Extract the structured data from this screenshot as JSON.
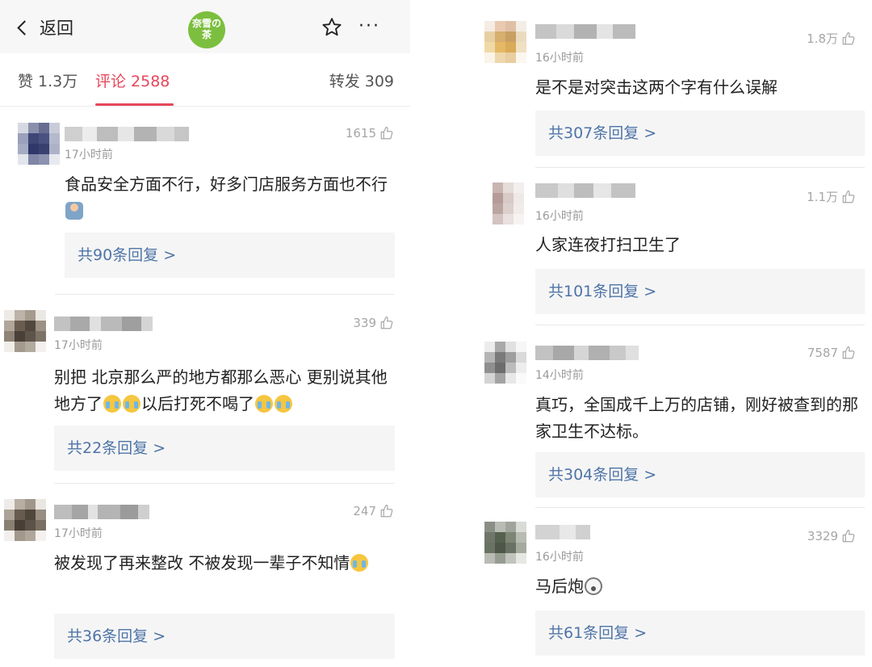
{
  "header": {
    "back_label": "返回",
    "logo_text": "奈雪の茶",
    "more_label": "···"
  },
  "tabs": {
    "likes": "赞 1.3万",
    "comments": "评论 2588",
    "reposts": "转发 309"
  },
  "accent_color": "#e7465a",
  "link_color": "#4e74a8",
  "left_comments": [
    {
      "time": "17小时前",
      "likes": "1615",
      "text": "食品安全方面不行，好多门店服务方面也不行",
      "replies": "共90条回复 >"
    },
    {
      "time": "17小时前",
      "likes": "339",
      "text": "别把 北京那么严的地方都那么恶心 更别说其他地方了",
      "text2": "以后打死不喝了",
      "replies": "共22条回复 >"
    },
    {
      "time": "17小时前",
      "likes": "247",
      "text": "被发现了再来整改 不被发现一辈子不知情",
      "replies": "共36条回复 >"
    }
  ],
  "right_comments": [
    {
      "time": "16小时前",
      "likes": "1.8万",
      "text": "是不是对突击这两个字有什么误解",
      "replies": "共307条回复 >"
    },
    {
      "time": "16小时前",
      "likes": "1.1万",
      "text": "人家连夜打扫卫生了",
      "replies": "共101条回复 >"
    },
    {
      "time": "14小时前",
      "likes": "7587",
      "text": "真巧，全国成千上万的店铺，刚好被查到的那家卫生不达标。",
      "replies": "共304条回复 >"
    },
    {
      "time": "16小时前",
      "likes": "3329",
      "text": "马后炮",
      "replies": "共61条回复 >"
    }
  ]
}
